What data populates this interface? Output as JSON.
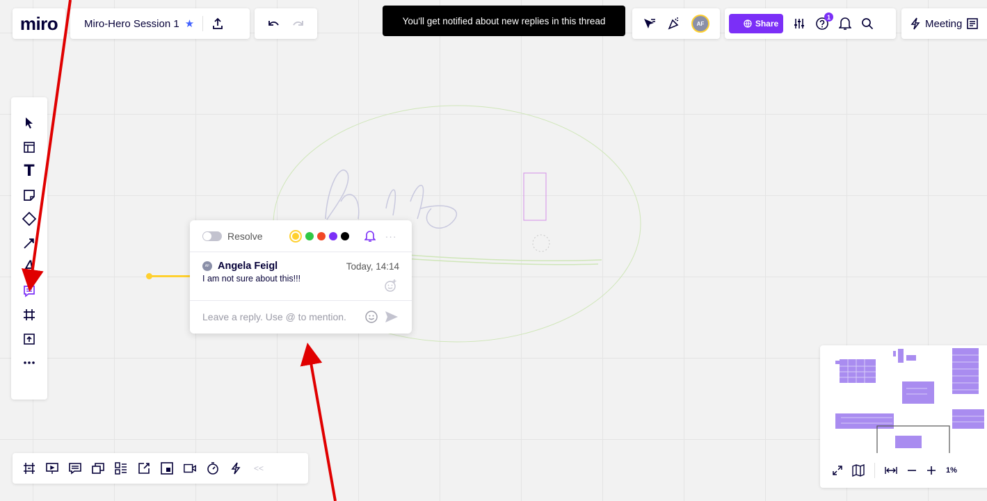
{
  "app": {
    "logo": "miro"
  },
  "board": {
    "title": "Miro-Hero Session 1",
    "star": "★"
  },
  "toast": {
    "message": "You'll get notified about new replies in this thread"
  },
  "header": {
    "avatar_initials": "AF",
    "share_label": "Share",
    "help_badge_count": "1",
    "meeting_label": "Meeting"
  },
  "left_toolbar": {
    "tools": [
      "select-icon",
      "templates-icon",
      "text-icon",
      "sticky-note-icon",
      "shape-icon",
      "connection-line-icon",
      "pen-icon",
      "comment-icon",
      "frame-icon",
      "upload-icon",
      "more-tools-icon"
    ],
    "text_tool_glyph": "T",
    "pen_tool_glyph": "A",
    "active_tool": "comment-icon",
    "active_color": "#7b2ff7"
  },
  "bottom_toolbar": {
    "tools": [
      "frames-icon",
      "presentation-icon",
      "comments-list-icon",
      "cards-icon",
      "kanban-icon",
      "embed-icon",
      "sticky-pack-icon",
      "video-icon",
      "timer-icon",
      "lightning-icon"
    ],
    "collapse_glyph": "<<"
  },
  "comment": {
    "resolve_label": "Resolve",
    "colors": [
      "#ffd02f",
      "#2fc845",
      "#f24726",
      "#7b2ff7",
      "#000000"
    ],
    "selected_color": "#ffd02f",
    "author_initials": "AF",
    "author": "Angela Feigl",
    "time": "Today, 14:14",
    "text": "I am not sure about this!!!",
    "reply_placeholder": "Leave a reply. Use @ to mention.",
    "more_glyph": "···"
  },
  "minimap": {
    "zoom_level": "1%"
  },
  "colors": {
    "accent": "#7b2ff7",
    "toast_bg": "#000000",
    "annotation_arrow": "#e00000",
    "connector": "#ffd02f"
  }
}
